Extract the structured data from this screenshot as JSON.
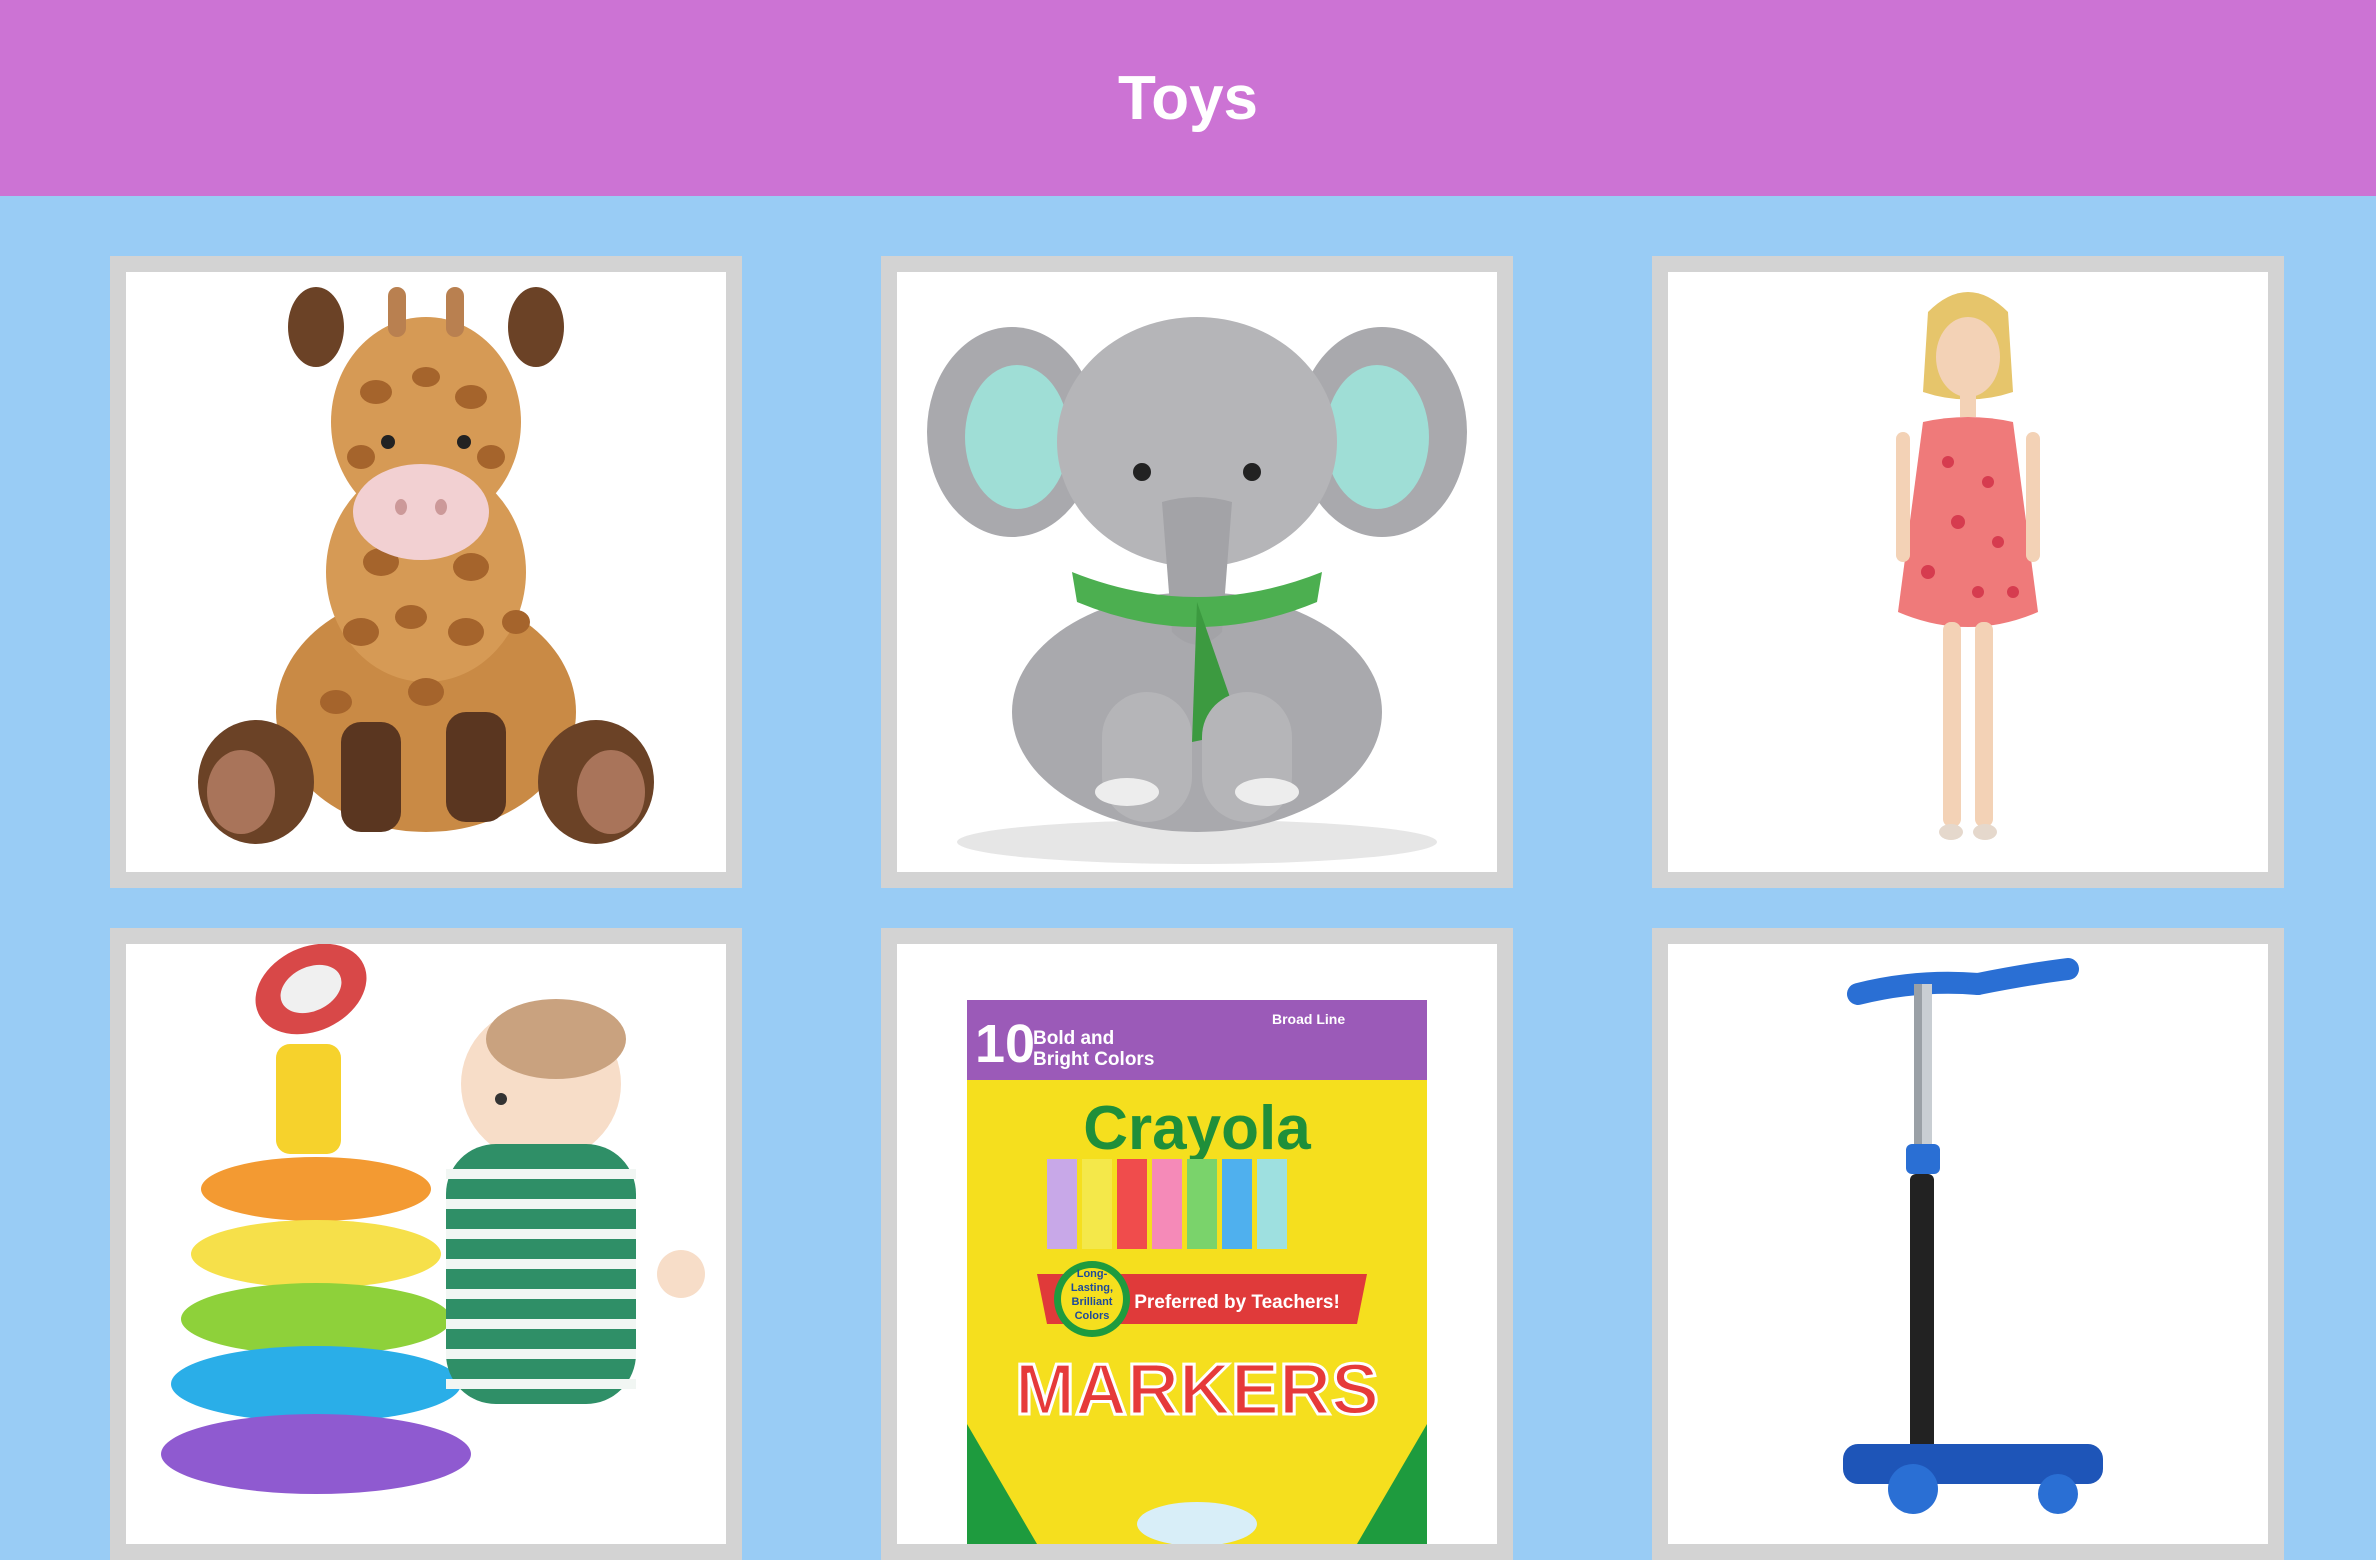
{
  "header": {
    "title": "Toys"
  },
  "colors": {
    "header_bg": "#cc73d4",
    "page_bg": "#99ccf5",
    "card_border": "#d3d3d3"
  },
  "products": [
    {
      "name": "giraffe-plush",
      "icon": "giraffe-icon"
    },
    {
      "name": "elephant-plush",
      "icon": "elephant-icon"
    },
    {
      "name": "fashion-doll",
      "icon": "doll-icon"
    },
    {
      "name": "stacking-rings",
      "icon": "rings-icon"
    },
    {
      "name": "crayola-markers",
      "icon": "markers-icon",
      "box": {
        "count": "10",
        "count_caption_1": "Bold and",
        "count_caption_2": "Bright Colors",
        "line_type": "Broad Line",
        "brand": "Crayola",
        "seal_1": "Long-",
        "seal_2": "Lasting,",
        "seal_3": "Brilliant",
        "seal_4": "Colors",
        "ribbon": "Preferred by Teachers!",
        "product": "MARKERS"
      }
    },
    {
      "name": "kick-scooter",
      "icon": "scooter-icon"
    }
  ]
}
